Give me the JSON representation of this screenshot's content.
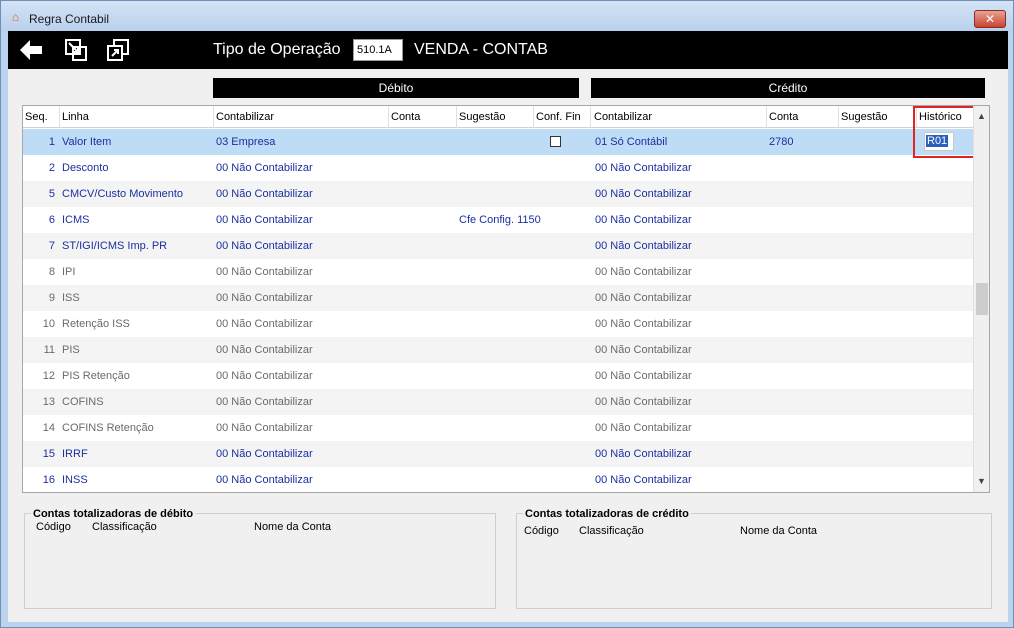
{
  "window": {
    "title": "Regra Contabil",
    "close_glyph": "✕"
  },
  "toolbar": {
    "operation_label": "Tipo de Operação",
    "operation_code": "510.1A",
    "operation_desc": "VENDA - CONTAB"
  },
  "sections": {
    "debit": "Débito",
    "credit": "Crédito"
  },
  "columns": {
    "seq": "Seq.",
    "linha": "Linha",
    "deb_contabilizar": "Contabilizar",
    "deb_conta": "Conta",
    "deb_sugestao": "Sugestão",
    "conf_fin": "Conf. Fin",
    "cred_contabilizar": "Contabilizar",
    "cred_conta": "Conta",
    "cred_sugestao": "Sugestão",
    "historico": "Histórico"
  },
  "rows": [
    {
      "seq": "1",
      "linha": "Valor Item",
      "deb_contab": "03 Empresa",
      "deb_sugestao": "",
      "cred_contab": "01 Só Contábil",
      "cred_conta": "2780",
      "historico": "R01",
      "style": "blue",
      "selected": true
    },
    {
      "seq": "2",
      "linha": "Desconto",
      "deb_contab": "00 Não Contabilizar",
      "deb_sugestao": "",
      "cred_contab": "00 Não Contabilizar",
      "cred_conta": "",
      "historico": "",
      "style": "blue"
    },
    {
      "seq": "5",
      "linha": "CMCV/Custo Movimento",
      "deb_contab": "00 Não Contabilizar",
      "deb_sugestao": "",
      "cred_contab": "00 Não Contabilizar",
      "cred_conta": "",
      "historico": "",
      "style": "blue"
    },
    {
      "seq": "6",
      "linha": "ICMS",
      "deb_contab": "00 Não Contabilizar",
      "deb_sugestao": "Cfe Config. 1150",
      "cred_contab": "00 Não Contabilizar",
      "cred_conta": "",
      "historico": "",
      "style": "blue"
    },
    {
      "seq": "7",
      "linha": "ST/IGI/ICMS Imp. PR",
      "deb_contab": "00 Não Contabilizar",
      "deb_sugestao": "",
      "cred_contab": "00 Não Contabilizar",
      "cred_conta": "",
      "historico": "",
      "style": "blue"
    },
    {
      "seq": "8",
      "linha": "IPI",
      "deb_contab": "00 Não Contabilizar",
      "deb_sugestao": "",
      "cred_contab": "00 Não Contabilizar",
      "cred_conta": "",
      "historico": "",
      "style": "gray"
    },
    {
      "seq": "9",
      "linha": "ISS",
      "deb_contab": "00 Não Contabilizar",
      "deb_sugestao": "",
      "cred_contab": "00 Não Contabilizar",
      "cred_conta": "",
      "historico": "",
      "style": "gray"
    },
    {
      "seq": "10",
      "linha": "Retenção ISS",
      "deb_contab": "00 Não Contabilizar",
      "deb_sugestao": "",
      "cred_contab": "00 Não Contabilizar",
      "cred_conta": "",
      "historico": "",
      "style": "gray"
    },
    {
      "seq": "11",
      "linha": "PIS",
      "deb_contab": "00 Não Contabilizar",
      "deb_sugestao": "",
      "cred_contab": "00 Não Contabilizar",
      "cred_conta": "",
      "historico": "",
      "style": "gray"
    },
    {
      "seq": "12",
      "linha": "PIS Retenção",
      "deb_contab": "00 Não Contabilizar",
      "deb_sugestao": "",
      "cred_contab": "00 Não Contabilizar",
      "cred_conta": "",
      "historico": "",
      "style": "gray"
    },
    {
      "seq": "13",
      "linha": "COFINS",
      "deb_contab": "00 Não Contabilizar",
      "deb_sugestao": "",
      "cred_contab": "00 Não Contabilizar",
      "cred_conta": "",
      "historico": "",
      "style": "gray"
    },
    {
      "seq": "14",
      "linha": "COFINS Retenção",
      "deb_contab": "00 Não Contabilizar",
      "deb_sugestao": "",
      "cred_contab": "00 Não Contabilizar",
      "cred_conta": "",
      "historico": "",
      "style": "gray"
    },
    {
      "seq": "15",
      "linha": "IRRF",
      "deb_contab": "00 Não Contabilizar",
      "deb_sugestao": "",
      "cred_contab": "00 Não Contabilizar",
      "cred_conta": "",
      "historico": "",
      "style": "blue"
    },
    {
      "seq": "16",
      "linha": "INSS",
      "deb_contab": "00 Não Contabilizar",
      "deb_sugestao": "",
      "cred_contab": "00 Não Contabilizar",
      "cred_conta": "",
      "historico": "",
      "style": "blue"
    }
  ],
  "totals_debit": {
    "title": "Contas totalizadoras de débito",
    "codigo": "Código",
    "classificacao": "Classificação",
    "nome": "Nome da Conta"
  },
  "totals_credit": {
    "title": "Contas totalizadoras de crédito",
    "codigo": "Código",
    "classificacao": "Classificação",
    "nome": "Nome da Conta"
  },
  "icons": {
    "back": "back-arrow-icon",
    "export": "export-icon",
    "windows": "windows-icon",
    "scroll_up": "▲",
    "scroll_down": "▼"
  },
  "colors": {
    "toolbar": "#000000",
    "selected_row": "#bfdcf7",
    "active_text": "#1a2f9e",
    "inactive_text": "#6a6a6a",
    "highlight_box": "#e02424"
  }
}
